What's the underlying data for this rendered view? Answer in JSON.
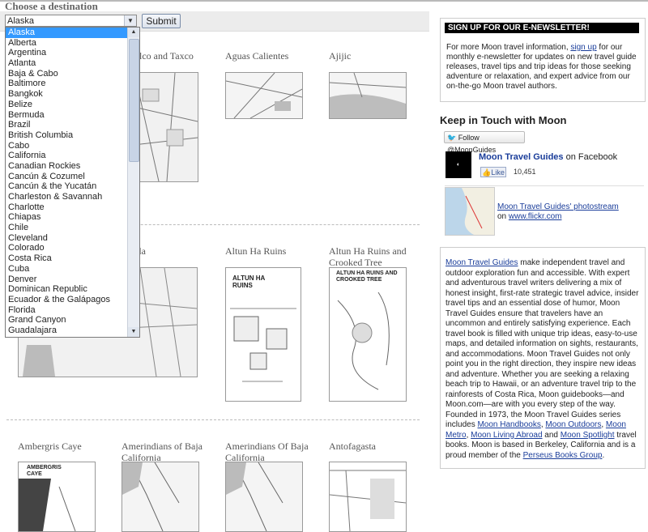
{
  "header": {
    "title": "Choose a destination"
  },
  "search": {
    "selected": "Alaska",
    "submit_label": "Submit"
  },
  "dropdown_options": [
    "Alaska",
    "Alberta",
    "Argentina",
    "Atlanta",
    "Baja & Cabo",
    "Baltimore",
    "Bangkok",
    "Belize",
    "Bermuda",
    "Brazil",
    "British Columbia",
    "Cabo",
    "California",
    "Canadian Rockies",
    "Cancún & Cozumel",
    "Cancún & the Yucatán",
    "Charleston & Savannah",
    "Charlotte",
    "Chiapas",
    "Chile",
    "Cleveland",
    "Colorado",
    "Costa Rica",
    "Cuba",
    "Denver",
    "Dominican Republic",
    "Ecuador & the Galápagos",
    "Florida",
    "Grand Canyon",
    "Guadalajara"
  ],
  "maps": {
    "row1": [
      "pulco and Taxco",
      "Aguas Calientes",
      "Ajijic"
    ],
    "row2": [
      "uela",
      "Altun Ha Ruins",
      "Altun Ha Ruins and Crooked Tree"
    ],
    "row3": [
      "Ambergris Caye",
      "Amerindians of Baja California",
      "Amerindians Of Baja California",
      "Antofagasta"
    ]
  },
  "map_labels": {
    "altun": "ALTUN HA RUINS",
    "altun_crooked": "ALTUN HA RUINS AND CROOKED TREE",
    "ambergris": "AMBERGRIS CAYE"
  },
  "newsletter": {
    "bar": "SIGN UP FOR OUR E-NEWSLETTER!",
    "t1": "For more Moon travel information, ",
    "signup": "sign up",
    "t2": " for our monthly e-newsletter for updates on new travel guide releases, travel tips and trip ideas for those seeking adventure or relaxation, and expert advice from our on-the-go Moon travel authors."
  },
  "social": {
    "heading": "Keep in Touch with Moon",
    "follow": "Follow @MoonGuides",
    "fb_name": "Moon Travel Guides",
    "fb_suffix": " on Facebook",
    "like": "Like",
    "like_count": "10,451",
    "flickr_link": "Moon Travel Guides' photostream",
    "flickr_on": "on ",
    "flickr_site": "www.flickr.com"
  },
  "about": {
    "link1": "Moon Travel Guides",
    "t1": " make independent travel and outdoor exploration fun and accessible. With expert and adventurous travel writers delivering a mix of honest insight, first-rate strategic travel advice, insider travel tips and an essential dose of humor, Moon Travel Guides ensure that travelers have an uncommon and entirely satisfying experience. Each travel book is filled with unique trip ideas, easy-to-use maps, and detailed information on sights, restaurants, and accommodations. Moon Travel Guides not only point you in the right direction, they inspire new ideas and adventure. Whether you are seeking a relaxing beach trip to Hawaii, or an adventure travel trip to the rainforests of Costa Rica, Moon guidebooks—and Moon.com—are with you every step of the way. Founded in 1973, the Moon Travel Guides series includes ",
    "link2": "Moon Handbooks",
    "c1": ", ",
    "link3": "Moon Outdoors",
    "c2": ", ",
    "link4": "Moon Metro",
    "c3": ", ",
    "link5": "Moon Living Abroad",
    "t2": " and ",
    "link6": "Moon Spotlight",
    "t3": " travel books. Moon is based in Berkeley, California and is a proud member of the ",
    "link7": "Perseus Books Group",
    "t4": "."
  }
}
